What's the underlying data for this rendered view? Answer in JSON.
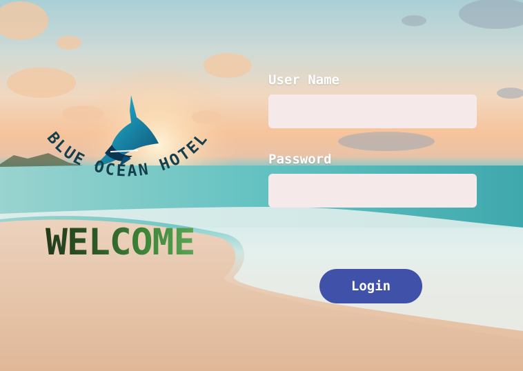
{
  "logo": {
    "brand_text": "BLUE OCEAN HOTEL",
    "icon": "shark-icon"
  },
  "welcome": "WELCOME",
  "form": {
    "username_label": "User Name",
    "username_value": "",
    "password_label": "Password",
    "password_value": "",
    "login_label": "Login"
  },
  "colors": {
    "field_bg": "#f5e9e9",
    "button_bg": "#3f51a8",
    "logo_text": "#163f4d",
    "welcome_dark": "#233a1c",
    "welcome_light": "#5aa456"
  }
}
